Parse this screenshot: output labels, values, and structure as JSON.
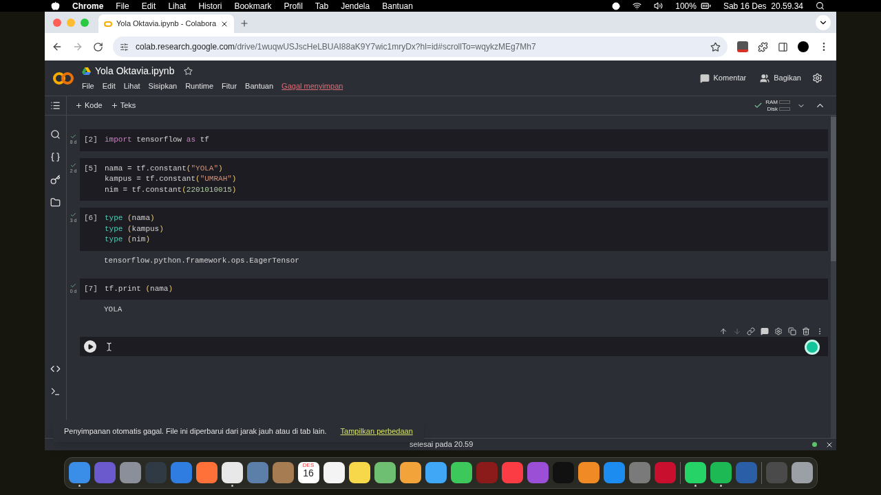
{
  "menubar": {
    "app": "Chrome",
    "menus": [
      "File",
      "Edit",
      "Lihat",
      "Histori",
      "Bookmark",
      "Profil",
      "Tab",
      "Jendela",
      "Bantuan"
    ],
    "battery": "100%",
    "clock": "Sab 16 Des  20.59.34"
  },
  "browser": {
    "tabs": [
      {
        "title": "Yola Oktavia.ipynb - Colabora",
        "selected": true
      }
    ],
    "url_host": "colab.research.google.com",
    "url_path": "/drive/1wuqwUSJscHeLBUAI88aK9Y7wic1mryDx?hl=id#scrollTo=wqykzMEg7Mh7"
  },
  "notebook": {
    "title": "Yola Oktavia.ipynb",
    "menus": [
      "File",
      "Edit",
      "Lihat",
      "Sisipkan",
      "Runtime",
      "Fitur",
      "Bantuan"
    ],
    "save_status": "Gagal menyimpan",
    "comment": "Komentar",
    "share": "Bagikan",
    "add_buttons": [
      "Kode",
      "Teks"
    ],
    "resources": [
      "RAM",
      "Disk"
    ]
  },
  "cells": [
    {
      "exec": "[2]",
      "time": "8 d",
      "lines": [
        [
          {
            "t": "import",
            "kind": "keyword"
          },
          {
            "t": " tensorflow ",
            "kind": "plain"
          },
          {
            "t": "as",
            "kind": "keyword"
          },
          {
            "t": " tf",
            "kind": "plain"
          }
        ]
      ]
    },
    {
      "exec": "[5]",
      "time": "2 d",
      "lines": [
        [
          {
            "t": "nama = tf.constant",
            "kind": "plain"
          },
          {
            "t": "(",
            "kind": "paren"
          },
          {
            "t": "\"YOLA\"",
            "kind": "string"
          },
          {
            "t": ")",
            "kind": "paren"
          }
        ],
        [
          {
            "t": "kampus = tf.constant",
            "kind": "plain"
          },
          {
            "t": "(",
            "kind": "paren"
          },
          {
            "t": "\"UMRAH\"",
            "kind": "string"
          },
          {
            "t": ")",
            "kind": "paren"
          }
        ],
        [
          {
            "t": "nim = tf.constant",
            "kind": "plain"
          },
          {
            "t": "(",
            "kind": "paren"
          },
          {
            "t": "2201010015",
            "kind": "number"
          },
          {
            "t": ")",
            "kind": "paren"
          }
        ]
      ]
    },
    {
      "exec": "[6]",
      "time": "3 d",
      "lines": [
        [
          {
            "t": "type",
            "kind": "builtin"
          },
          {
            "t": " (",
            "kind": "paren"
          },
          {
            "t": "nama",
            "kind": "plain"
          },
          {
            "t": ")",
            "kind": "paren"
          }
        ],
        [
          {
            "t": "type",
            "kind": "builtin"
          },
          {
            "t": " (",
            "kind": "paren"
          },
          {
            "t": "kampus",
            "kind": "plain"
          },
          {
            "t": ")",
            "kind": "paren"
          }
        ],
        [
          {
            "t": "type",
            "kind": "builtin"
          },
          {
            "t": " (",
            "kind": "paren"
          },
          {
            "t": "nim",
            "kind": "plain"
          },
          {
            "t": ")",
            "kind": "paren"
          }
        ]
      ],
      "output": "tensorflow.python.framework.ops.EagerTensor"
    },
    {
      "exec": "[7]",
      "time": "0 d",
      "lines": [
        [
          {
            "t": "tf.print ",
            "kind": "plain"
          },
          {
            "t": "(",
            "kind": "paren"
          },
          {
            "t": "nama",
            "kind": "plain"
          },
          {
            "t": ")",
            "kind": "paren"
          }
        ]
      ],
      "output": "YOLA"
    }
  ],
  "toast": {
    "message": "Penyimpanan otomatis gagal. File ini diperbarui dari jarak jauh atau di tab lain.",
    "link": "Tampilkan perbedaan"
  },
  "status": {
    "text": "selesai pada 20.59"
  },
  "dock": [
    {
      "kind": "app",
      "color": "#3b8ee8",
      "running": true
    },
    {
      "kind": "app",
      "color": "#6a5acd",
      "running": false
    },
    {
      "kind": "app",
      "color": "#8a8f99",
      "running": false
    },
    {
      "kind": "app",
      "color": "#2f3a44",
      "running": false
    },
    {
      "kind": "app",
      "color": "#2f7de1",
      "running": false
    },
    {
      "kind": "app",
      "color": "#ff7139",
      "running": false
    },
    {
      "kind": "app",
      "color": "#e8e8e8",
      "running": true
    },
    {
      "kind": "app",
      "color": "#5b7fa8",
      "running": false
    },
    {
      "kind": "app",
      "color": "#a67c52",
      "running": false
    },
    {
      "kind": "calendar",
      "month": "DES",
      "day": "16",
      "running": false
    },
    {
      "kind": "app",
      "color": "#f4f4f4",
      "running": false
    },
    {
      "kind": "app",
      "color": "#f7d84a",
      "running": false
    },
    {
      "kind": "app",
      "color": "#6fbf73",
      "running": false
    },
    {
      "kind": "app",
      "color": "#f2a33a",
      "running": false
    },
    {
      "kind": "app",
      "color": "#3fa7f5",
      "running": false
    },
    {
      "kind": "app",
      "color": "#3cc85a",
      "running": false
    },
    {
      "kind": "app",
      "color": "#8b1a1a",
      "running": false
    },
    {
      "kind": "app",
      "color": "#fc3c44",
      "running": false
    },
    {
      "kind": "app",
      "color": "#9b4fd6",
      "running": false
    },
    {
      "kind": "app",
      "color": "#111111",
      "running": false
    },
    {
      "kind": "app",
      "color": "#f08a24",
      "running": false
    },
    {
      "kind": "app",
      "color": "#1c8cf0",
      "running": false
    },
    {
      "kind": "app",
      "color": "#7a7a7a",
      "running": false
    },
    {
      "kind": "app",
      "color": "#c8102e",
      "running": false
    },
    {
      "kind": "separator"
    },
    {
      "kind": "app",
      "color": "#25d366",
      "running": true
    },
    {
      "kind": "app",
      "color": "#1db954",
      "running": true
    },
    {
      "kind": "app",
      "color": "#2a5fa8",
      "running": false
    },
    {
      "kind": "separator"
    },
    {
      "kind": "app",
      "color": "#4a4a4a",
      "running": false
    },
    {
      "kind": "app",
      "color": "#9aa0a6",
      "running": false
    }
  ]
}
